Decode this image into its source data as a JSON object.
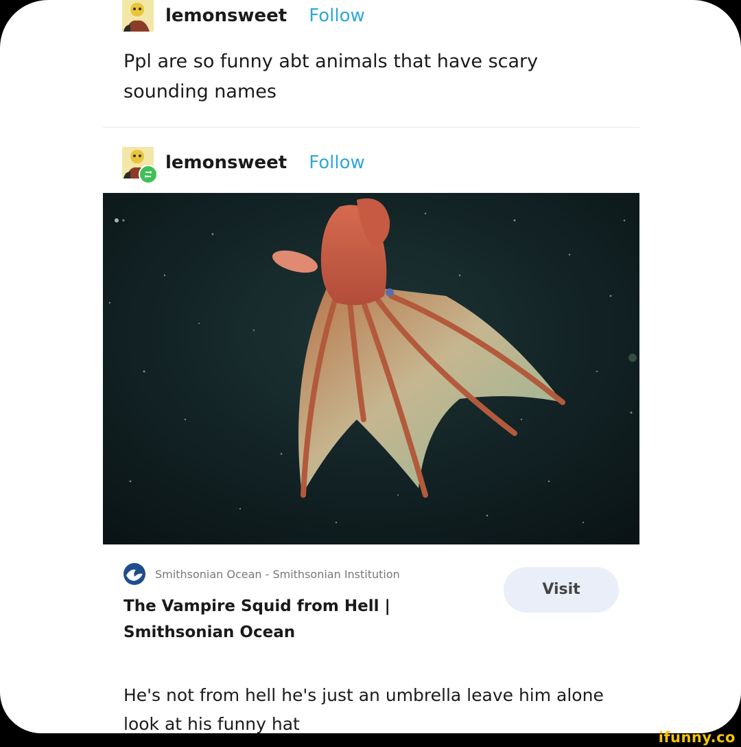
{
  "post1": {
    "username": "lemonsweet",
    "follow_label": "Follow",
    "text": "Ppl are so funny abt animals that have scary sounding names"
  },
  "post2": {
    "username": "lemonsweet",
    "follow_label": "Follow"
  },
  "link_card": {
    "source": "Smithsonian Ocean - Smithsonian Institution",
    "title": "The Vampire Squid from Hell | Smithsonian Ocean",
    "visit_label": "Visit"
  },
  "comment": {
    "text": "He's not from hell he's just an umbrella leave him alone look at his funny hat"
  },
  "watermark": "ifunny.co",
  "colors": {
    "follow": "#2ea7d8",
    "reblog_badge": "#3fbf57",
    "visit_bg": "#e9eef8",
    "watermark": "#f6c600"
  },
  "icons": {
    "avatar": "avatar-icon",
    "reblog": "reblog-icon",
    "source": "smithsonian-wave-icon"
  }
}
